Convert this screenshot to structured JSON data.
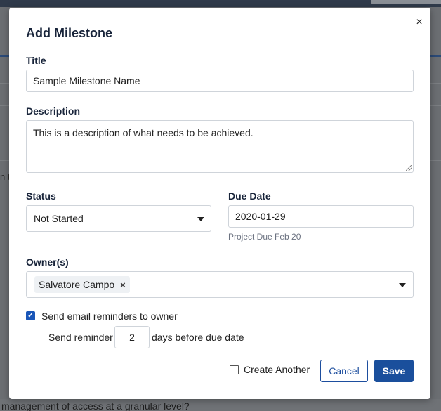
{
  "background": {
    "fragment_left": "n t",
    "bottom_text": "management of access at a granular level?"
  },
  "modal": {
    "title": "Add Milestone",
    "close_glyph": "×",
    "title_field": {
      "label": "Title",
      "value": "Sample Milestone Name"
    },
    "description_field": {
      "label": "Description",
      "value": "This is a description of what needs to be achieved."
    },
    "status_field": {
      "label": "Status",
      "selected": "Not Started"
    },
    "due_date_field": {
      "label": "Due Date",
      "value": "2020-01-29",
      "hint": "Project Due Feb 20"
    },
    "owners_field": {
      "label": "Owner(s)",
      "chips": [
        "Salvatore Campo"
      ],
      "chip_remove_glyph": "×"
    },
    "reminders": {
      "checkbox_label": "Send email reminders to owner",
      "checked": true,
      "prefix": "Send reminder",
      "days": "2",
      "suffix": "days before due date"
    },
    "footer": {
      "create_another_label": "Create Another",
      "create_another_checked": false,
      "cancel_label": "Cancel",
      "save_label": "Save"
    }
  },
  "colors": {
    "primary": "#1a4f9c",
    "title_text": "#18243a",
    "overlay": "#6b6e72"
  }
}
